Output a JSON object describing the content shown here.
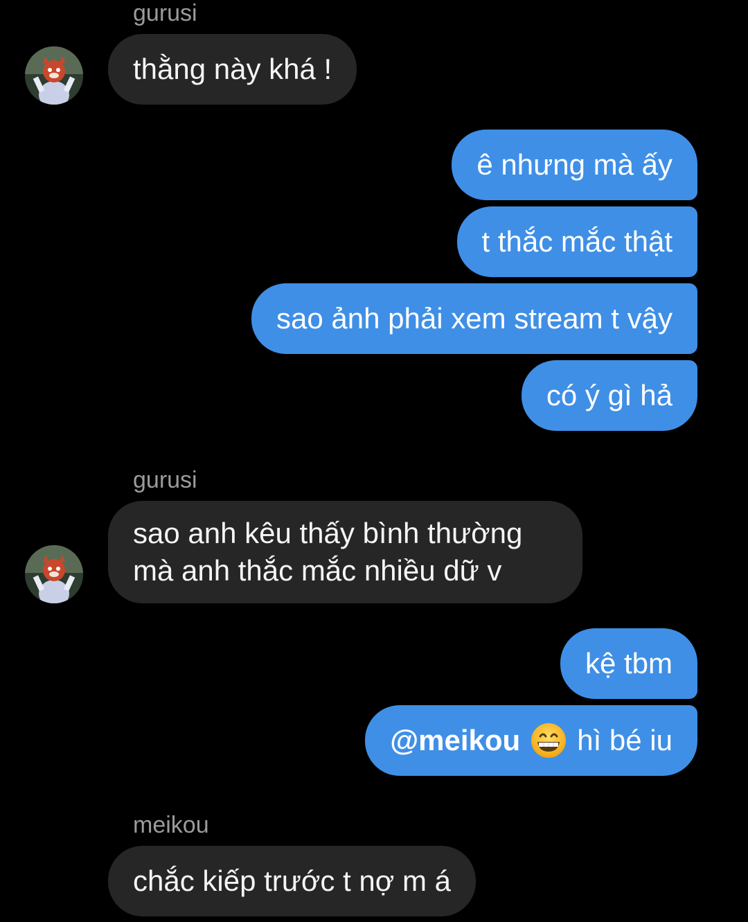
{
  "messages": {
    "m1": {
      "sender": "gurusi",
      "text": "thằng này khá !"
    },
    "m2": {
      "text": "ê nhưng mà ấy"
    },
    "m3": {
      "text": "t thắc mắc thật"
    },
    "m4": {
      "text": "sao ảnh phải xem stream t vậy"
    },
    "m5": {
      "text": "có ý gì hả"
    },
    "m6": {
      "sender": "gurusi",
      "line1": "sao anh kêu thấy bình thường",
      "line2": "mà anh thắc mắc nhiều dữ v"
    },
    "m7": {
      "text": "kệ tbm"
    },
    "m8": {
      "mention": "@meikou",
      "emoji": "grinning-face-emoji",
      "text": "hì bé iu"
    },
    "m9": {
      "sender": "meikou",
      "text": "chắc kiếp trước t nợ m á"
    }
  },
  "colors": {
    "background": "#000000",
    "incoming_bubble": "#262626",
    "outgoing_bubble": "#3f8fe6",
    "sender_name": "#9b9b9b"
  }
}
